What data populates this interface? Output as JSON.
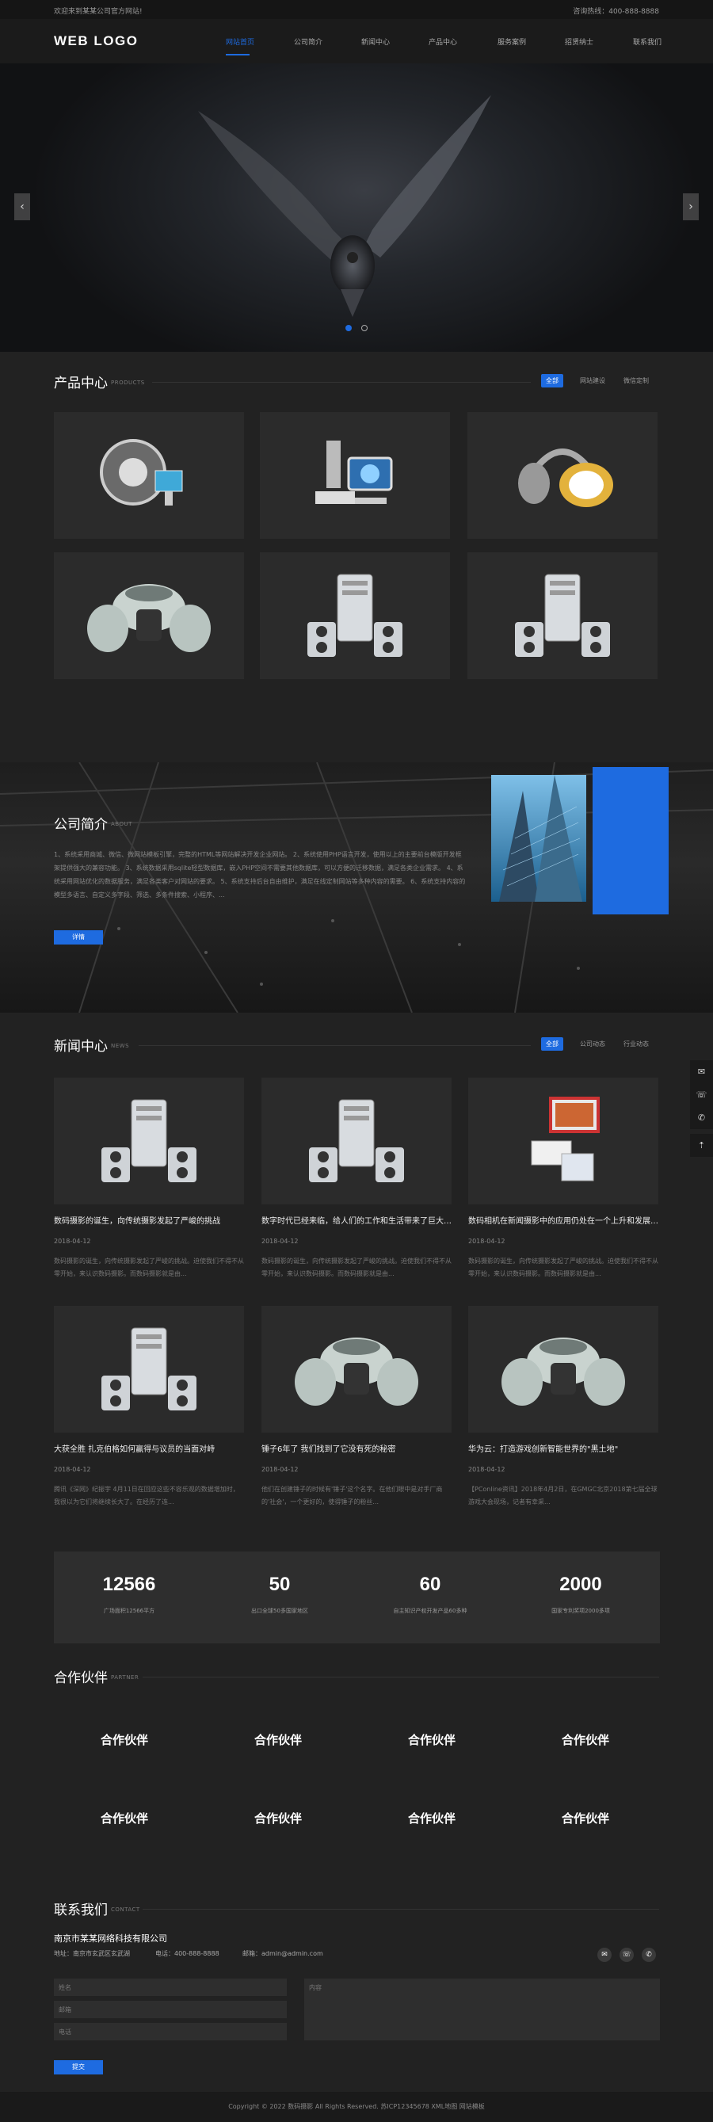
{
  "topbar": {
    "welcome": "欢迎来到某某公司官方网站!",
    "hotline": "咨询热线：400-888-8888"
  },
  "header": {
    "logo": "WEB LOGO",
    "nav": [
      "网站首页",
      "公司简介",
      "新闻中心",
      "产品中心",
      "服务案例",
      "招贤纳士",
      "联系我们"
    ],
    "active_index": 0
  },
  "banner": {
    "prev_icon": "chevron-left-icon",
    "next_icon": "chevron-right-icon",
    "slide_count": 2,
    "active_slide": 0
  },
  "products": {
    "title": "产品中心",
    "sub": "PRODUCTS",
    "tabs": [
      "全部",
      "网站建设",
      "微信定制"
    ],
    "items": [
      "gear-robot",
      "microscope-monitor",
      "headphones",
      "vintage-car",
      "computer-tower",
      "computer-tower"
    ]
  },
  "about": {
    "title": "公司简介",
    "sub": "ABOUT",
    "text": "1、系统采用商城、微信、微网站模板引擎，完整的HTML等网站解决开发企业网站。 2、系统使用PHP语言开发，使用以上的主要前台模版开发框架提供强大的兼容功能。 3、系统数据采用sqlite轻型数据库，嵌入PHP空间不需要其他数据库，可以方便的迁移数据，满足各类企业需求。 4、系统采用网站优化的数据服务，满足各类客户对网站的要求。 5、系统支持后台自由维护，满足在线定制网站等多种内容的需要。 6、系统支持内容的模型多语言、自定义多字段、筛选、多条件搜索、小程序、... ",
    "btn": "详情"
  },
  "news": {
    "title": "新闻中心",
    "sub": "NEWS",
    "tabs": [
      "全部",
      "公司动态",
      "行业动态"
    ],
    "items": [
      {
        "title": "数码摄影的诞生，向传统摄影发起了严峻的挑战",
        "date": "2018-04-12",
        "desc": "数码摄影的诞生，向传统摄影发起了严峻的挑战。迫使我们不得不从零开始，来认识数码摄影。而数码摄影就是由...",
        "img": "computer-tower"
      },
      {
        "title": "数字时代已经来临，给人们的工作和生活带来了巨大的变化",
        "date": "2018-04-12",
        "desc": "数码摄影的诞生，向传统摄影发起了严峻的挑战。迫使我们不得不从零开始，来认识数码摄影。而数码摄影就是由...",
        "img": "computer-tower"
      },
      {
        "title": "数码相机在新闻摄影中的应用仍处在一个上升和发展阶段",
        "date": "2018-04-12",
        "desc": "数码摄影的诞生，向传统摄影发起了严峻的挑战。迫使我们不得不从零开始，来认识数码摄影。而数码摄影就是由...",
        "img": "monitor-printer"
      },
      {
        "title": "大获全胜 扎克伯格如何赢得与议员的当面对峙",
        "date": "2018-04-12",
        "desc": "腾讯《深网》纪振宇 4月11日在回应这些不容乐观的数据增加时，我很以为它们将继续长大了。在经历了连...",
        "img": "computer-tower"
      },
      {
        "title": "锤子6年了 我们找到了它没有死的秘密",
        "date": "2018-04-12",
        "desc": "他们在创建锤子的时候有'锤子'这个名字。在他们眼中是对手厂商的'社会'，一个更好的，使得锤子的粉丝...",
        "img": "vintage-car"
      },
      {
        "title": "华为云：打造游戏创新智能世界的\"黑土地\"",
        "date": "2018-04-12",
        "desc": "【PConline资讯】2018年4月2日，在GMGC北京2018第七届全球游戏大会现场，记者有幸采...",
        "img": "vintage-car"
      }
    ]
  },
  "stats": [
    {
      "num": "12566",
      "lbl": "广场面积12566平方"
    },
    {
      "num": "50",
      "lbl": "出口全球50多国家地区"
    },
    {
      "num": "60",
      "lbl": "自主知识产权开发产品60多种"
    },
    {
      "num": "2000",
      "lbl": "国家专利奖项2000多项"
    }
  ],
  "partners": {
    "title": "合作伙伴",
    "sub": "PARTNER",
    "items": [
      "合作伙伴",
      "合作伙伴",
      "合作伙伴",
      "合作伙伴",
      "合作伙伴",
      "合作伙伴",
      "合作伙伴",
      "合作伙伴"
    ]
  },
  "contact": {
    "title": "联系我们",
    "sub": "CONTACT",
    "company": "南京市某某网络科技有限公司",
    "address": "地址：南京市玄武区玄武湖",
    "phone": "电话：400-888-8888",
    "email": "邮箱：admin@admin.com",
    "ph_name": "姓名",
    "ph_email": "邮箱",
    "ph_phone": "电话",
    "ph_content": "内容",
    "submit": "提交"
  },
  "footer": "Copyright © 2022 数码摄影 All Rights Reserved. 苏ICP12345678 XML地图 网站模板",
  "colors": {
    "accent": "#1e6be0",
    "bg": "#222222"
  }
}
